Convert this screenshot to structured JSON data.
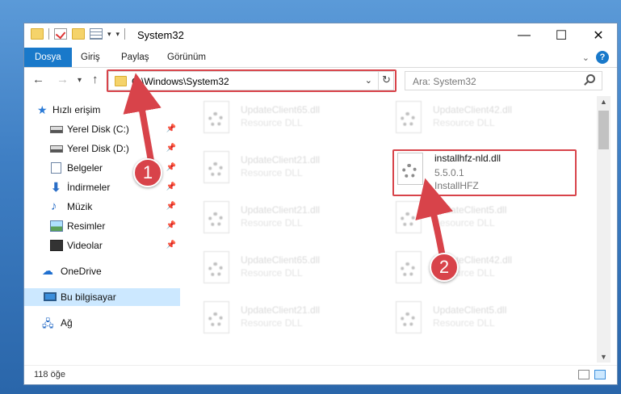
{
  "window": {
    "title": "System32",
    "controls": {
      "minimize": "—",
      "maximize": "☐",
      "close": "✕"
    }
  },
  "ribbon": {
    "tabs": [
      "Dosya",
      "Giriş",
      "Paylaş",
      "Görünüm"
    ],
    "help": "?"
  },
  "navigation": {
    "address_path": "C:\\Windows\\System32",
    "search_placeholder": "Ara: System32"
  },
  "sidebar": {
    "items": [
      {
        "label": "Hızlı erişim",
        "icon": "star-icon",
        "pinned": false
      },
      {
        "label": "Yerel Disk (C:)",
        "icon": "disk-icon",
        "pinned": true
      },
      {
        "label": "Yerel Disk (D:)",
        "icon": "disk-icon",
        "pinned": true
      },
      {
        "label": "Belgeler",
        "icon": "documents-icon",
        "pinned": true
      },
      {
        "label": "İndirmeler",
        "icon": "download-icon",
        "pinned": true
      },
      {
        "label": "Müzik",
        "icon": "music-icon",
        "pinned": true
      },
      {
        "label": "Resimler",
        "icon": "pictures-icon",
        "pinned": true
      },
      {
        "label": "Videolar",
        "icon": "videos-icon",
        "pinned": true
      },
      {
        "label": "OneDrive",
        "icon": "cloud-icon",
        "pinned": false
      },
      {
        "label": "Bu bilgisayar",
        "icon": "computer-icon",
        "pinned": false,
        "selected": true
      },
      {
        "label": "Ağ",
        "icon": "network-icon",
        "pinned": false
      }
    ]
  },
  "files": [
    {
      "name": "UpdateClient65.dll",
      "desc": "Resource DLL"
    },
    {
      "name": "UpdateClient42.dll",
      "desc": "Resource DLL"
    },
    {
      "name": "UpdateClient21.dll",
      "desc": "Resource DLL"
    },
    {
      "name": "installhfz-nld.dll",
      "version": "5.5.0.1",
      "desc": "InstallHFZ",
      "highlighted": true
    },
    {
      "name": "UpdateClient21.dll",
      "desc": "Resource DLL"
    },
    {
      "name": "UpdateClient5.dll",
      "desc": "Resource DLL"
    },
    {
      "name": "UpdateClient65.dll",
      "desc": "Resource DLL"
    },
    {
      "name": "UpdateClient42.dll",
      "desc": "Resource DLL"
    },
    {
      "name": "UpdateClient21.dll",
      "desc": "Resource DLL"
    },
    {
      "name": "UpdateClient5.dll",
      "desc": "Resource DLL"
    }
  ],
  "status": {
    "item_count": "118 öğe"
  },
  "annotations": {
    "step1": "1",
    "step2": "2",
    "color": "#d8434a"
  }
}
